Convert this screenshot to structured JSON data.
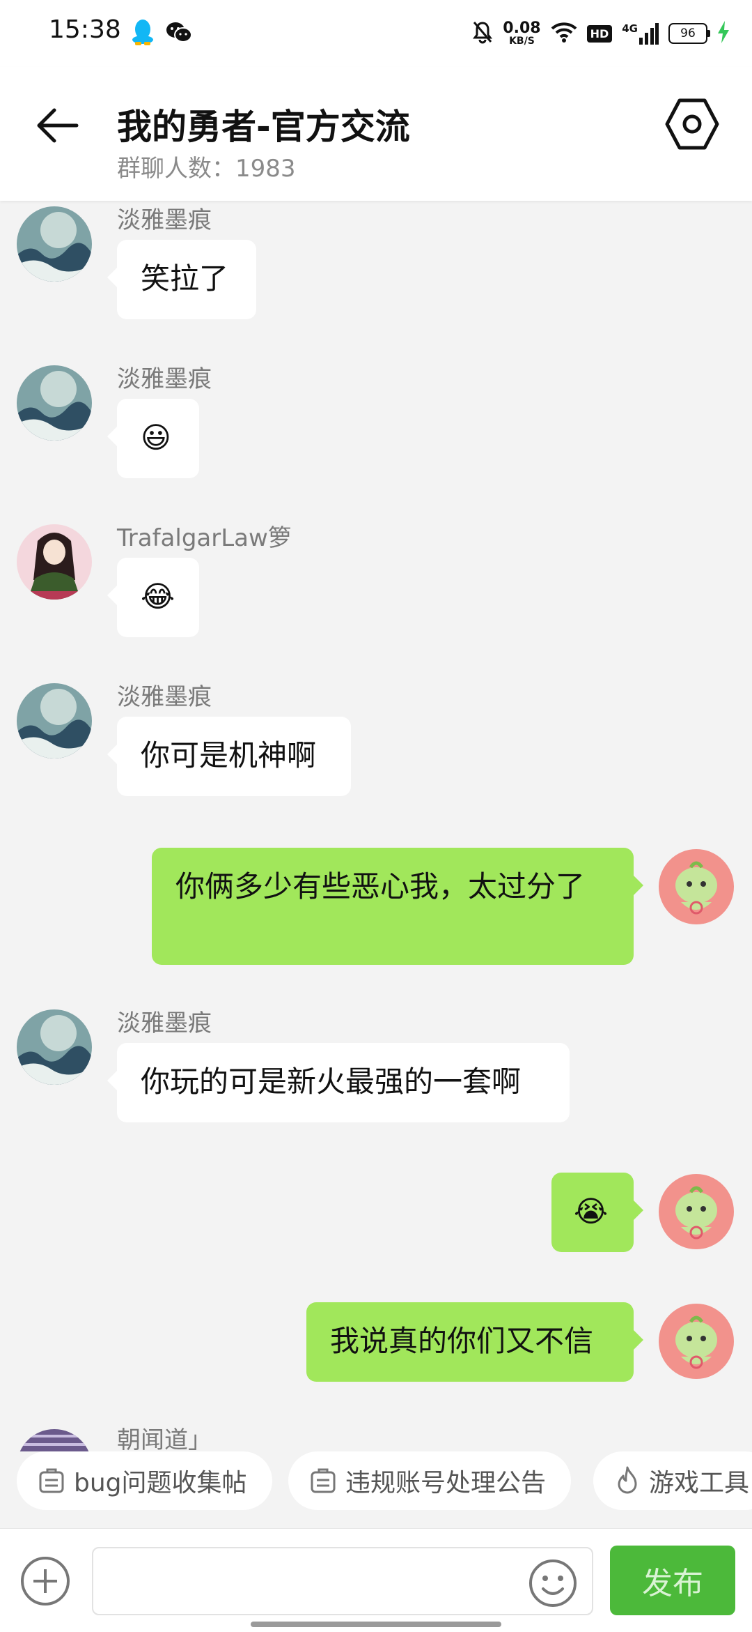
{
  "status_bar": {
    "time": "15:38",
    "net_speed_value": "0.08",
    "net_speed_unit": "KB/S",
    "hd_badge": "HD",
    "network_type": "4G",
    "battery_level": "96"
  },
  "header": {
    "title": "我的勇者-官方交流",
    "member_count": "群聊人数：1983"
  },
  "messages": [
    {
      "sender": "淡雅墨痕",
      "text": "笑拉了",
      "direction": "incoming"
    },
    {
      "sender": "淡雅墨痕",
      "text": "😃",
      "direction": "incoming"
    },
    {
      "sender": "TrafalgarLaw箩",
      "text": "😂",
      "direction": "incoming"
    },
    {
      "sender": "淡雅墨痕",
      "text": "你可是机神啊",
      "direction": "incoming"
    },
    {
      "text": "你俩多少有些恶心我，太过分了",
      "direction": "outgoing"
    },
    {
      "sender": "淡雅墨痕",
      "text": "你玩的可是新火最强的一套啊",
      "direction": "incoming"
    },
    {
      "text": "😭",
      "direction": "outgoing"
    },
    {
      "text": "我说真的你们又不信",
      "direction": "outgoing"
    },
    {
      "sender": "朝闻道」",
      "direction": "incoming"
    }
  ],
  "shortcuts": [
    {
      "label": "bug问题收集帖",
      "icon": "notice-icon"
    },
    {
      "label": "违规账号处理公告",
      "icon": "notice-icon"
    },
    {
      "label": "游戏工具",
      "icon": "fire-icon"
    }
  ],
  "input_bar": {
    "publish_label": "发布",
    "input_value": ""
  },
  "colors": {
    "outgoing_bubble": "#a1e75b",
    "incoming_bubble": "#ffffff",
    "publish_button": "#4cb93a",
    "chat_background": "#f3f3f3"
  }
}
